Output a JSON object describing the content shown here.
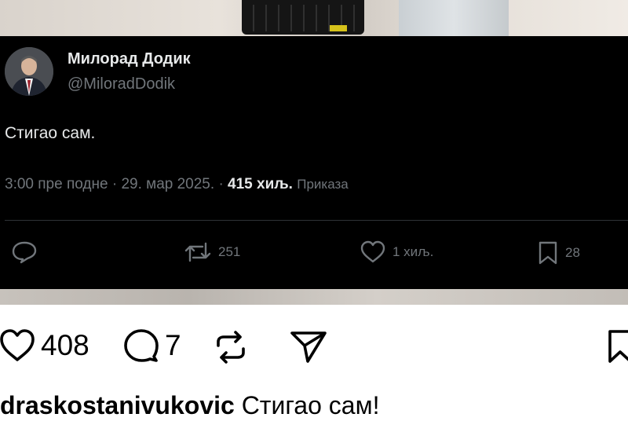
{
  "tweet": {
    "author_name": "Милорад Додик",
    "author_handle": "@MiloradDodik",
    "text": "Стигао сам.",
    "time": "3:00 пре подне",
    "separator": "·",
    "date": "29. мар 2025.",
    "views_count": "415 хиљ.",
    "views_label": "Приказа",
    "actions": {
      "reply_count": "",
      "retweet_count": "251",
      "like_count": "1 хиљ.",
      "bookmark_count": "28"
    },
    "colors": {
      "background": "#000000",
      "primary_text": "#e7e9ea",
      "secondary_text": "#71767b"
    }
  },
  "instagram": {
    "likes": "408",
    "comments": "7",
    "caption_user": "draskostanivukovic",
    "caption_text": "Стигао сам!"
  }
}
